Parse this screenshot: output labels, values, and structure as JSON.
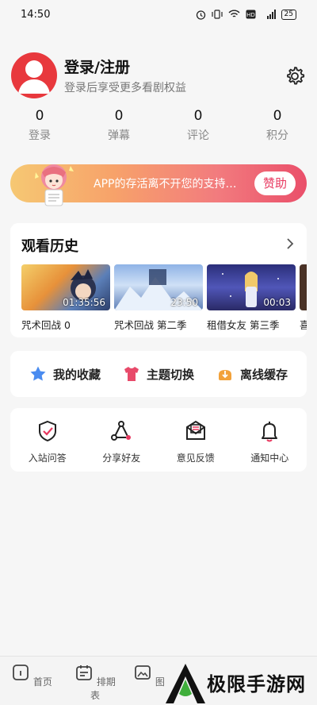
{
  "status_bar": {
    "time": "14:50",
    "signal_text": "4G",
    "battery": "25"
  },
  "profile": {
    "title": "登录/注册",
    "subtitle": "登录后享受更多看剧权益"
  },
  "stats": [
    {
      "value": "0",
      "label": "登录"
    },
    {
      "value": "0",
      "label": "弹幕"
    },
    {
      "value": "0",
      "label": "评论"
    },
    {
      "value": "0",
      "label": "积分"
    }
  ],
  "banner": {
    "text": "APP的存活离不开您的支持…",
    "button": "赞助"
  },
  "history": {
    "title": "观看历史",
    "items": [
      {
        "label": "咒术回战 0",
        "time": "01:35:56"
      },
      {
        "label": "咒术回战 第二季",
        "time": "23:50"
      },
      {
        "label": "租借女友 第三季",
        "time": "00:03"
      },
      {
        "label": "喜"
      }
    ]
  },
  "quick": [
    {
      "label": "我的收藏",
      "icon": "star-icon"
    },
    {
      "label": "主题切换",
      "icon": "tshirt-icon"
    },
    {
      "label": "离线缓存",
      "icon": "download-icon"
    }
  ],
  "tools": [
    {
      "label": "入站问答",
      "icon": "shield-check-icon"
    },
    {
      "label": "分享好友",
      "icon": "share-icon"
    },
    {
      "label": "意见反馈",
      "icon": "mail-icon"
    },
    {
      "label": "通知中心",
      "icon": "bell-icon"
    }
  ],
  "bottom_nav": [
    {
      "label": "首页",
      "icon": "home-icon"
    },
    {
      "label": "排期表",
      "icon": "calendar-icon"
    },
    {
      "label": "图",
      "icon": "image-icon"
    }
  ],
  "watermark": {
    "text": "极限手游网"
  },
  "colors": {
    "accent": "#e8385f",
    "avatar": "#e8383d",
    "star": "#4a8cf0",
    "tshirt": "#e84a6a",
    "download": "#f2a13a"
  }
}
